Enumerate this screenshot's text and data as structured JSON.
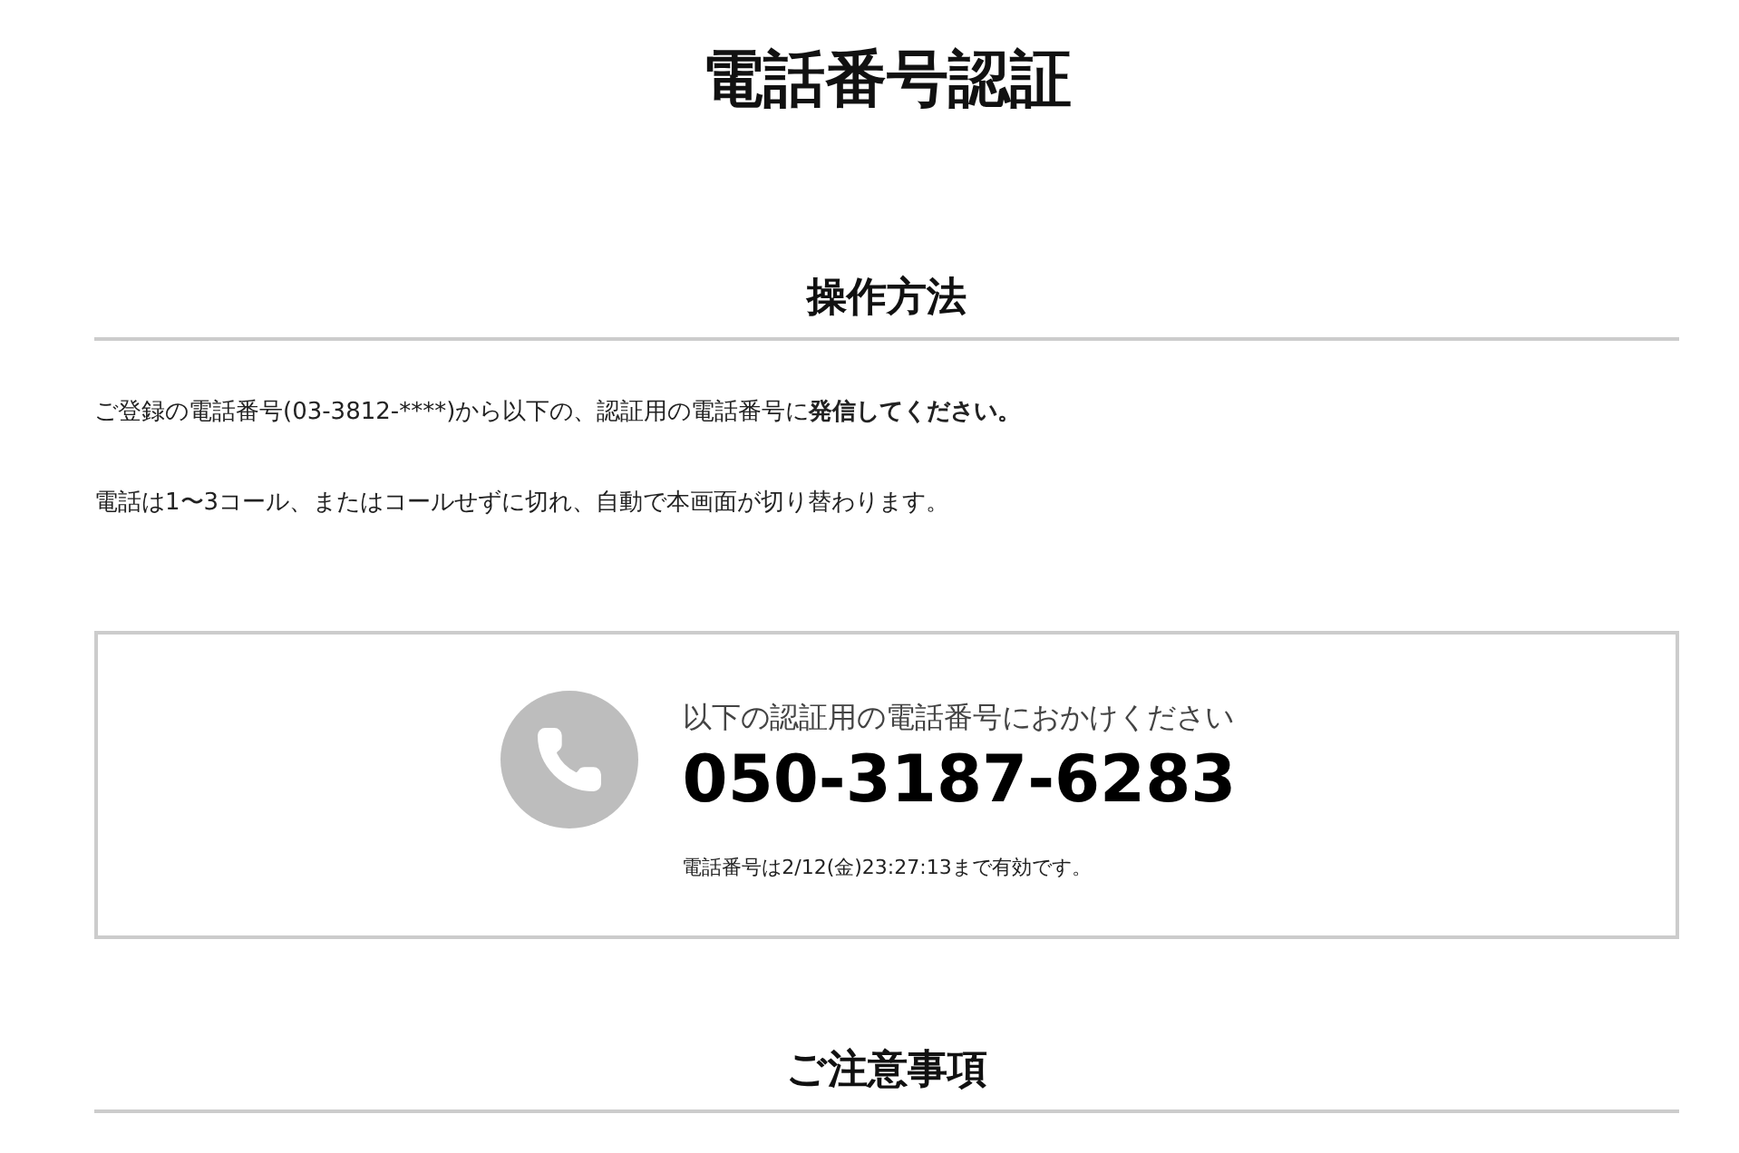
{
  "title": "電話番号認証",
  "sections": [
    {
      "heading": "操作方法"
    },
    {
      "heading": "ご注意事項"
    }
  ],
  "instructions": [
    {
      "text": "ご登録の電話番号(03-3812-****)から以下の、認証用の電話番号に",
      "emphasis": "発信してください。"
    },
    {
      "text": "電話は1〜3コール、またはコールせずに切れ、自動で本画面が切り替わります。"
    }
  ],
  "call_box": {
    "prompt": "以下の認証用の電話番号におかけください",
    "number": "050-3187-6283",
    "validity": "電話番号は2/12(金)23:27:13まで有効です。"
  }
}
